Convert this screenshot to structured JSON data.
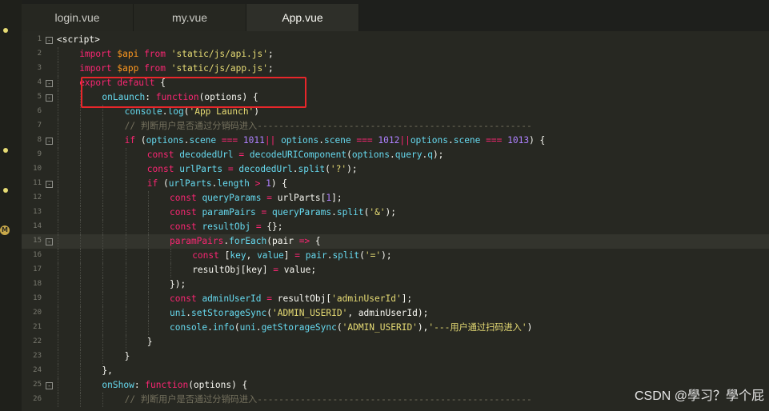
{
  "tabs": [
    {
      "label": "login.vue",
      "active": false
    },
    {
      "label": "my.vue",
      "active": false
    },
    {
      "label": "App.vue",
      "active": true
    }
  ],
  "watermark": "CSDN @學习？學个屁",
  "colors": {
    "editor_bg": "#272822",
    "annotation_box": "#e8262a"
  },
  "code_lines": [
    {
      "n": "1",
      "fold": "-",
      "indent": 0,
      "tokens": [
        [
          "w",
          "<script>"
        ]
      ]
    },
    {
      "n": "2",
      "fold": "",
      "indent": 1,
      "tokens": [
        [
          "k",
          "import"
        ],
        [
          "w",
          " "
        ],
        [
          "v",
          "$api"
        ],
        [
          "w",
          " "
        ],
        [
          "k",
          "from"
        ],
        [
          "w",
          " "
        ],
        [
          "s",
          "'static/js/api.js'"
        ],
        [
          "w",
          ";"
        ]
      ]
    },
    {
      "n": "3",
      "fold": "",
      "indent": 1,
      "tokens": [
        [
          "k",
          "import"
        ],
        [
          "w",
          " "
        ],
        [
          "v",
          "$app"
        ],
        [
          "w",
          " "
        ],
        [
          "k",
          "from"
        ],
        [
          "w",
          " "
        ],
        [
          "s",
          "'static/js/app.js'"
        ],
        [
          "w",
          ";"
        ]
      ]
    },
    {
      "n": "4",
      "fold": "-",
      "indent": 1,
      "tokens": [
        [
          "k",
          "export"
        ],
        [
          "w",
          " "
        ],
        [
          "k",
          "default"
        ],
        [
          "w",
          " {"
        ]
      ]
    },
    {
      "n": "5",
      "fold": "-",
      "indent": 2,
      "tokens": [
        [
          "b",
          "onLaunch"
        ],
        [
          "w",
          ": "
        ],
        [
          "k",
          "function"
        ],
        [
          "w",
          "(options) {"
        ]
      ]
    },
    {
      "n": "6",
      "fold": "",
      "indent": 3,
      "tokens": [
        [
          "b",
          "console"
        ],
        [
          "w",
          "."
        ],
        [
          "b",
          "log"
        ],
        [
          "w",
          "("
        ],
        [
          "s",
          "'App Launch'"
        ],
        [
          "w",
          ")"
        ]
      ]
    },
    {
      "n": "7",
      "fold": "",
      "indent": 3,
      "tokens": [
        [
          "c",
          "// 判断用户是否通过分销码进入---------------------------------------------------"
        ]
      ]
    },
    {
      "n": "8",
      "fold": "-",
      "indent": 3,
      "tokens": [
        [
          "k",
          "if"
        ],
        [
          "w",
          " ("
        ],
        [
          "b",
          "options"
        ],
        [
          "w",
          "."
        ],
        [
          "b",
          "scene"
        ],
        [
          "w",
          " "
        ],
        [
          "k",
          "==="
        ],
        [
          "w",
          " "
        ],
        [
          "n",
          "1011"
        ],
        [
          "k",
          "||"
        ],
        [
          "w",
          " "
        ],
        [
          "b",
          "options"
        ],
        [
          "w",
          "."
        ],
        [
          "b",
          "scene"
        ],
        [
          "w",
          " "
        ],
        [
          "k",
          "==="
        ],
        [
          "w",
          " "
        ],
        [
          "n",
          "1012"
        ],
        [
          "k",
          "||"
        ],
        [
          "b",
          "options"
        ],
        [
          "w",
          "."
        ],
        [
          "b",
          "scene"
        ],
        [
          "w",
          " "
        ],
        [
          "k",
          "==="
        ],
        [
          "w",
          " "
        ],
        [
          "n",
          "1013"
        ],
        [
          "w",
          ") {"
        ]
      ]
    },
    {
      "n": "9",
      "fold": "",
      "indent": 4,
      "tokens": [
        [
          "k",
          "const"
        ],
        [
          "w",
          " "
        ],
        [
          "b",
          "decodedUrl"
        ],
        [
          "w",
          " "
        ],
        [
          "k",
          "="
        ],
        [
          "w",
          " "
        ],
        [
          "b",
          "decodeURIComponent"
        ],
        [
          "w",
          "("
        ],
        [
          "b",
          "options"
        ],
        [
          "w",
          "."
        ],
        [
          "b",
          "query"
        ],
        [
          "w",
          "."
        ],
        [
          "b",
          "q"
        ],
        [
          "w",
          ");"
        ]
      ]
    },
    {
      "n": "10",
      "fold": "",
      "indent": 4,
      "tokens": [
        [
          "k",
          "const"
        ],
        [
          "w",
          " "
        ],
        [
          "b",
          "urlParts"
        ],
        [
          "w",
          " "
        ],
        [
          "k",
          "="
        ],
        [
          "w",
          " "
        ],
        [
          "b",
          "decodedUrl"
        ],
        [
          "w",
          "."
        ],
        [
          "b",
          "split"
        ],
        [
          "w",
          "("
        ],
        [
          "s",
          "'?'"
        ],
        [
          "w",
          ");"
        ]
      ]
    },
    {
      "n": "11",
      "fold": "-",
      "indent": 4,
      "tokens": [
        [
          "k",
          "if"
        ],
        [
          "w",
          " ("
        ],
        [
          "b",
          "urlParts"
        ],
        [
          "w",
          "."
        ],
        [
          "b",
          "length"
        ],
        [
          "w",
          " "
        ],
        [
          "k",
          ">"
        ],
        [
          "w",
          " "
        ],
        [
          "n",
          "1"
        ],
        [
          "w",
          ") {"
        ]
      ]
    },
    {
      "n": "12",
      "fold": "",
      "indent": 5,
      "tokens": [
        [
          "k",
          "const"
        ],
        [
          "w",
          " "
        ],
        [
          "b",
          "queryParams"
        ],
        [
          "w",
          " "
        ],
        [
          "k",
          "="
        ],
        [
          "w",
          " urlParts["
        ],
        [
          "n",
          "1"
        ],
        [
          "w",
          "];"
        ]
      ]
    },
    {
      "n": "13",
      "fold": "",
      "indent": 5,
      "tokens": [
        [
          "k",
          "const"
        ],
        [
          "w",
          " "
        ],
        [
          "b",
          "paramPairs"
        ],
        [
          "w",
          " "
        ],
        [
          "k",
          "="
        ],
        [
          "w",
          " "
        ],
        [
          "b",
          "queryParams"
        ],
        [
          "w",
          "."
        ],
        [
          "b",
          "split"
        ],
        [
          "w",
          "("
        ],
        [
          "s",
          "'&'"
        ],
        [
          "w",
          ");"
        ]
      ]
    },
    {
      "n": "14",
      "fold": "",
      "indent": 5,
      "tokens": [
        [
          "k",
          "const"
        ],
        [
          "w",
          " "
        ],
        [
          "b",
          "resultObj"
        ],
        [
          "w",
          " "
        ],
        [
          "k",
          "="
        ],
        [
          "w",
          " {};"
        ]
      ]
    },
    {
      "n": "15",
      "fold": "-",
      "indent": 5,
      "highlight": true,
      "tokens": [
        [
          "k",
          "paramPairs"
        ],
        [
          "w",
          "."
        ],
        [
          "b",
          "forEach"
        ],
        [
          "w",
          "(pair "
        ],
        [
          "k",
          "=>"
        ],
        [
          "w",
          " {"
        ]
      ]
    },
    {
      "n": "16",
      "fold": "",
      "indent": 6,
      "tokens": [
        [
          "k",
          "const"
        ],
        [
          "w",
          " ["
        ],
        [
          "b",
          "key"
        ],
        [
          "w",
          ", "
        ],
        [
          "b",
          "value"
        ],
        [
          "w",
          "] "
        ],
        [
          "k",
          "="
        ],
        [
          "w",
          " "
        ],
        [
          "b",
          "pair"
        ],
        [
          "w",
          "."
        ],
        [
          "b",
          "split"
        ],
        [
          "w",
          "("
        ],
        [
          "s",
          "'='"
        ],
        [
          "w",
          ");"
        ]
      ]
    },
    {
      "n": "17",
      "fold": "",
      "indent": 6,
      "tokens": [
        [
          "w",
          "resultObj[key] "
        ],
        [
          "k",
          "="
        ],
        [
          "w",
          " value;"
        ]
      ]
    },
    {
      "n": "18",
      "fold": "",
      "indent": 5,
      "tokens": [
        [
          "w",
          "});"
        ]
      ]
    },
    {
      "n": "19",
      "fold": "",
      "indent": 5,
      "tokens": [
        [
          "k",
          "const"
        ],
        [
          "w",
          " "
        ],
        [
          "b",
          "adminUserId"
        ],
        [
          "w",
          " "
        ],
        [
          "k",
          "="
        ],
        [
          "w",
          " resultObj["
        ],
        [
          "s",
          "'adminUserId'"
        ],
        [
          "w",
          "];"
        ]
      ]
    },
    {
      "n": "20",
      "fold": "",
      "indent": 5,
      "tokens": [
        [
          "b",
          "uni"
        ],
        [
          "w",
          "."
        ],
        [
          "b",
          "setStorageSync"
        ],
        [
          "w",
          "("
        ],
        [
          "s",
          "'ADMIN_USERID'"
        ],
        [
          "w",
          ", adminUserId);"
        ]
      ]
    },
    {
      "n": "21",
      "fold": "",
      "indent": 5,
      "tokens": [
        [
          "b",
          "console"
        ],
        [
          "w",
          "."
        ],
        [
          "b",
          "info"
        ],
        [
          "w",
          "("
        ],
        [
          "b",
          "uni"
        ],
        [
          "w",
          "."
        ],
        [
          "b",
          "getStorageSync"
        ],
        [
          "w",
          "("
        ],
        [
          "s",
          "'ADMIN_USERID'"
        ],
        [
          "w",
          "),"
        ],
        [
          "s",
          "'---用户通过扫码进入'"
        ],
        [
          "w",
          ")"
        ]
      ]
    },
    {
      "n": "22",
      "fold": "",
      "indent": 4,
      "tokens": [
        [
          "w",
          "}"
        ]
      ]
    },
    {
      "n": "23",
      "fold": "",
      "indent": 3,
      "tokens": [
        [
          "w",
          "}"
        ]
      ]
    },
    {
      "n": "24",
      "fold": "",
      "indent": 2,
      "tokens": [
        [
          "w",
          "},"
        ]
      ]
    },
    {
      "n": "25",
      "fold": "-",
      "indent": 2,
      "tokens": [
        [
          "b",
          "onShow"
        ],
        [
          "w",
          ": "
        ],
        [
          "k",
          "function"
        ],
        [
          "w",
          "(options) {"
        ]
      ]
    },
    {
      "n": "26",
      "fold": "",
      "indent": 3,
      "tokens": [
        [
          "c",
          "// 判断用户是否通过分销码进入---------------------------------------------------"
        ]
      ]
    }
  ]
}
